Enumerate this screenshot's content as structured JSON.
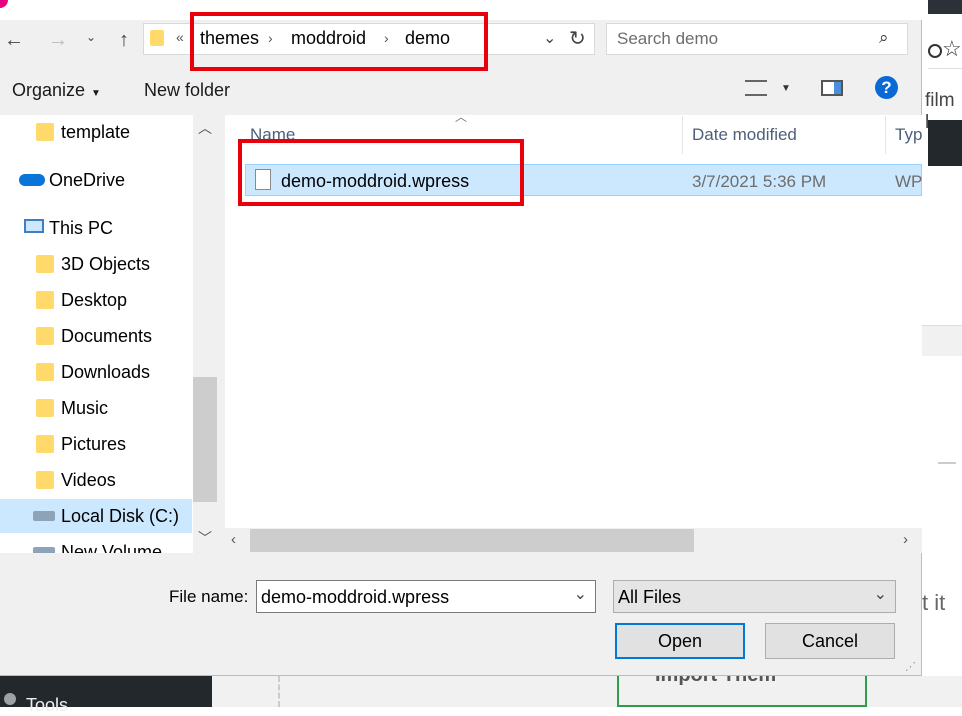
{
  "dialog": {
    "breadcrumb": {
      "overflow": "«",
      "items": [
        "themes",
        "moddroid",
        "demo"
      ]
    },
    "search_placeholder": "Search demo",
    "toolbar": {
      "organize": "Organize",
      "new_folder": "New folder"
    },
    "nav": {
      "items": [
        {
          "label": "template",
          "icon": "folder-icon"
        },
        {
          "label": "OneDrive",
          "icon": "cloud-icon"
        },
        {
          "label": "This PC",
          "icon": "computer-icon"
        },
        {
          "label": "3D Objects",
          "icon": "3d-objects-icon"
        },
        {
          "label": "Desktop",
          "icon": "desktop-icon"
        },
        {
          "label": "Documents",
          "icon": "documents-icon"
        },
        {
          "label": "Downloads",
          "icon": "downloads-icon"
        },
        {
          "label": "Music",
          "icon": "music-icon"
        },
        {
          "label": "Pictures",
          "icon": "pictures-icon"
        },
        {
          "label": "Videos",
          "icon": "videos-icon"
        },
        {
          "label": "Local Disk (C:)",
          "icon": "drive-icon"
        },
        {
          "label": "New Volume (E:)",
          "icon": "drive-icon"
        }
      ]
    },
    "columns": {
      "name": "Name",
      "date": "Date modified",
      "type": "Typ"
    },
    "files": [
      {
        "name": "demo-moddroid.wpress",
        "date": "3/7/2021 5:36 PM",
        "type": "WP"
      }
    ],
    "file_name_label": "File name:",
    "file_name_value": "demo-moddroid.wpress",
    "file_type": "All Files",
    "open_label": "Open",
    "cancel_label": "Cancel"
  },
  "background": {
    "text_film": "film l",
    "text_it": "t it",
    "text_tools": "Tools",
    "text_green": "Import Them"
  },
  "colors": {
    "selection": "#cce8ff",
    "highlight_box": "#e8000b",
    "default_button_border": "#0078d7"
  }
}
